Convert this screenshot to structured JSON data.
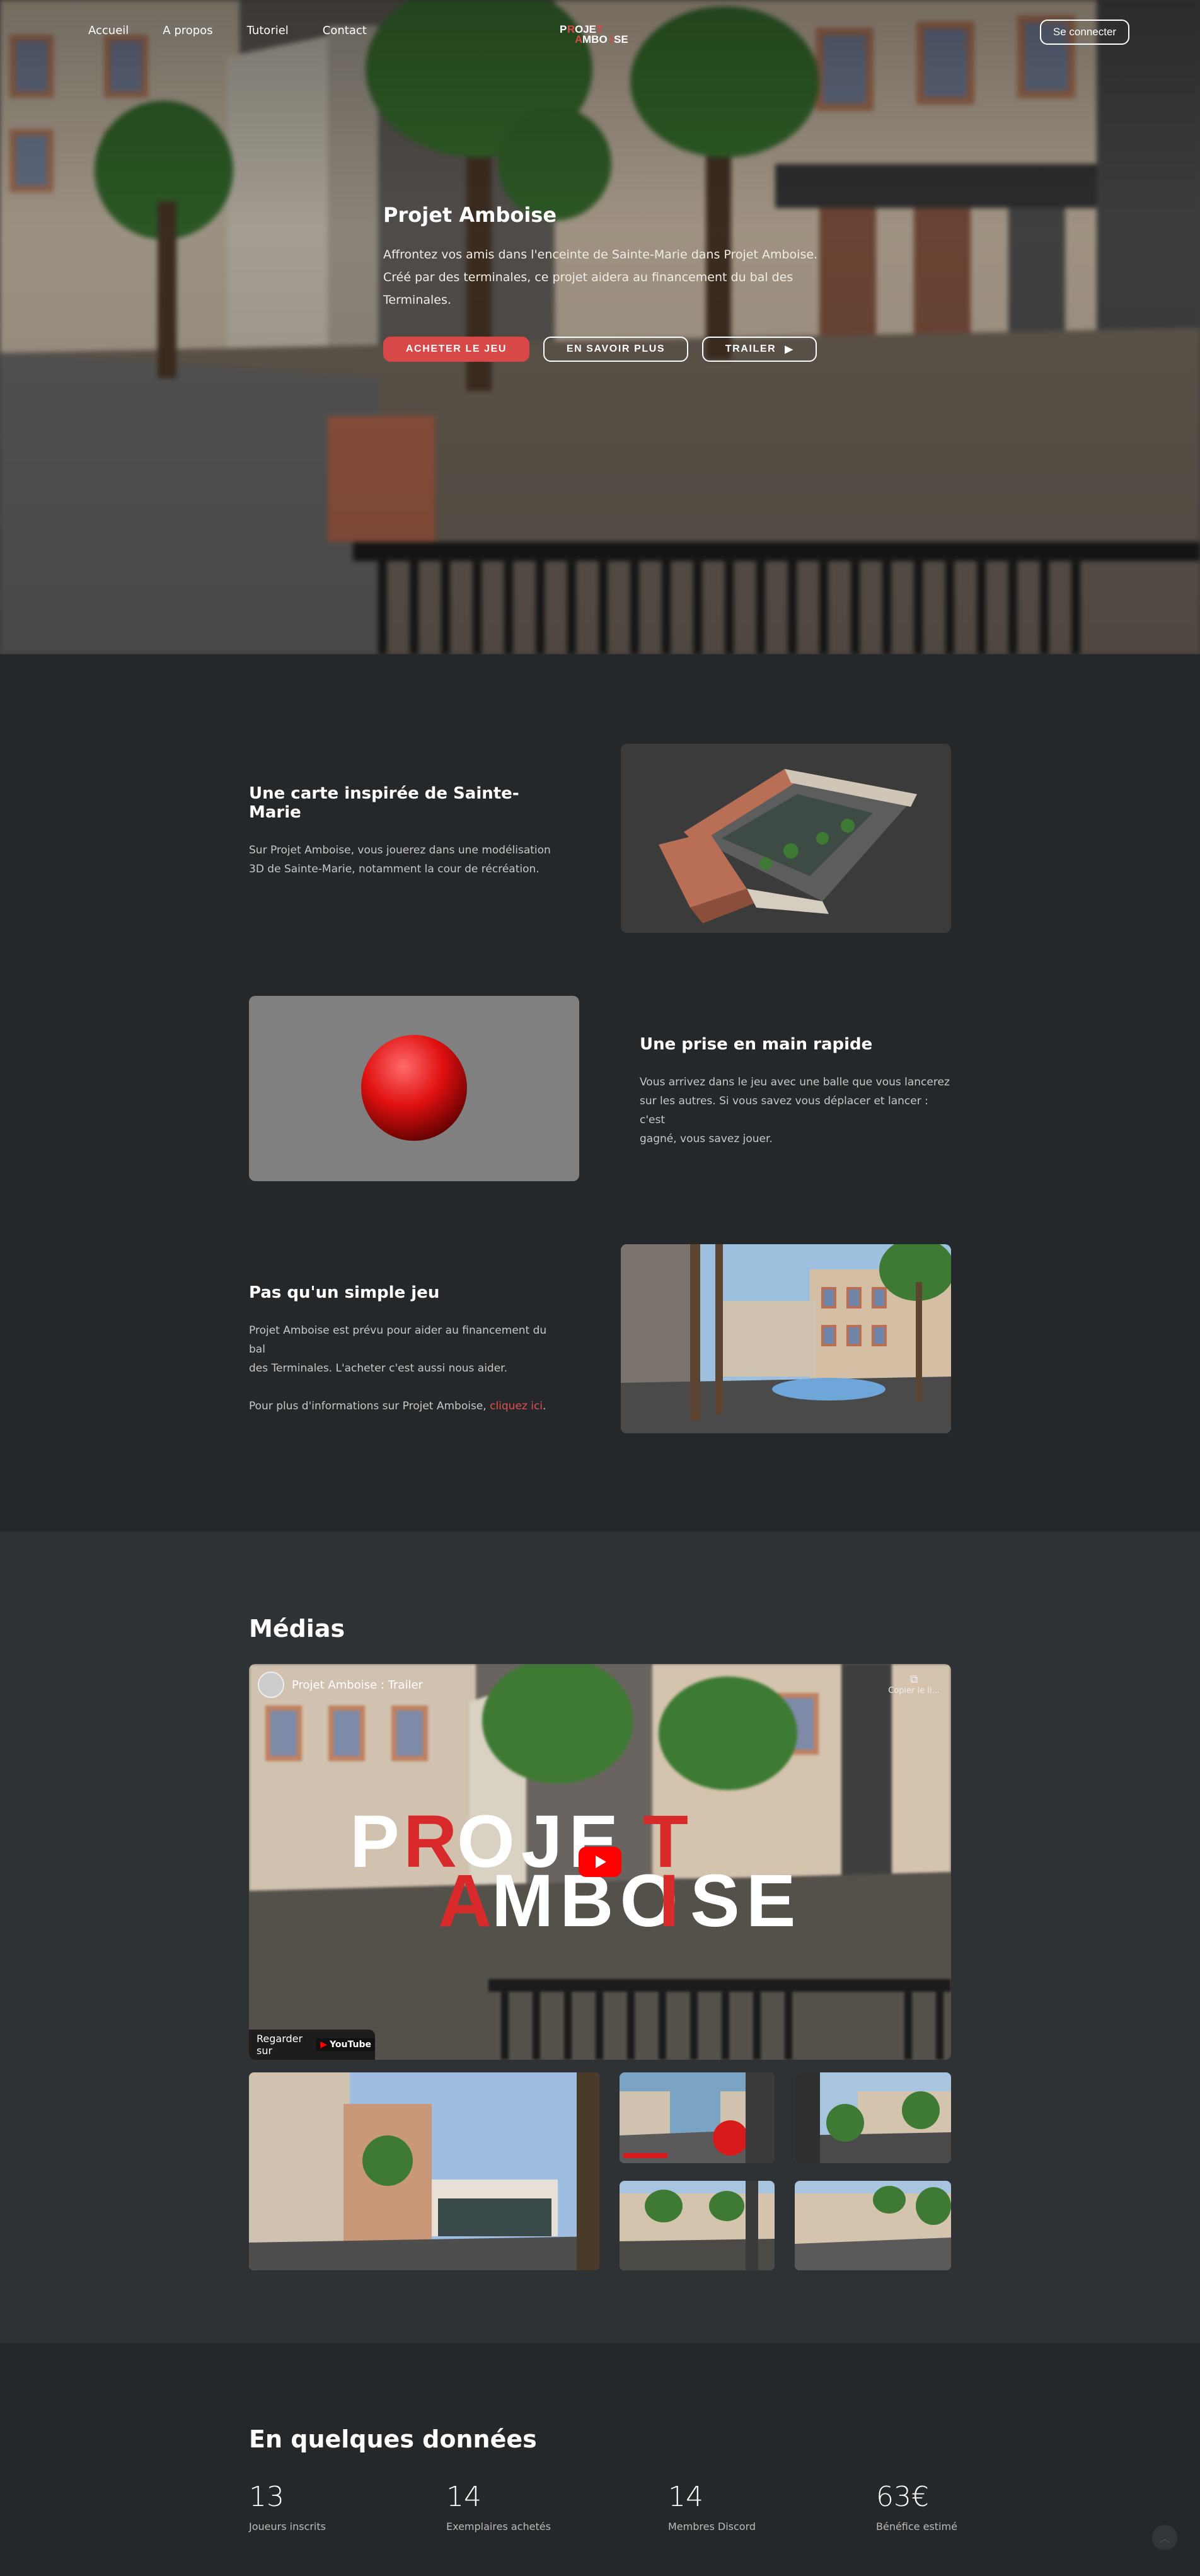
{
  "nav": {
    "links": [
      "Accueil",
      "A propos",
      "Tutoriel",
      "Contact"
    ],
    "logo_text": "PROJET AMBOISE",
    "login_label": "Se connecter"
  },
  "hero": {
    "title": "Projet Amboise",
    "line1": "Affrontez vos amis dans l'enceinte de Sainte-Marie dans Projet Amboise.",
    "line2": "Créé par des terminales, ce projet aidera au financement du bal des Terminales.",
    "buy_label": "ACHETER LE JEU",
    "more_label": "EN SAVOIR PLUS",
    "trailer_label": "TRAILER"
  },
  "features": [
    {
      "title": "Une carte inspirée de Sainte-Marie",
      "body": [
        "Sur Projet Amboise, vous jouerez dans une modélisation",
        "3D de Sainte-Marie, notamment la cour de récréation."
      ]
    },
    {
      "title": "Une prise en main rapide",
      "body": [
        "Vous arrivez dans le jeu avec une balle que vous lancerez",
        "sur les autres. Si vous savez vous déplacer et lancer : c'est",
        "gagné, vous savez jouer."
      ]
    },
    {
      "title": "Pas qu'un simple jeu",
      "body": [
        "Projet Amboise est prévu pour aider au financement du bal",
        "des Terminales. L'acheter c'est aussi nous aider."
      ],
      "more_prefix": "Pour plus d'informations sur Projet Amboise,",
      "more_link": "cliquez ici",
      "more_suffix": "."
    }
  ],
  "media": {
    "title": "Médias",
    "video_channel_title": "Projet Amboise : Trailer",
    "copy_label": "Copier le li...",
    "watch_label": "Regarder sur",
    "youtube_label": "YouTube",
    "video_logo_top": "PROJET",
    "video_logo_bottom": "AMBOISE"
  },
  "stats": {
    "title": "En quelques données",
    "items": [
      {
        "value": "13",
        "label": "Joueurs inscrits"
      },
      {
        "value": "14",
        "label": "Exemplaires achetés"
      },
      {
        "value": "14",
        "label": "Membres Discord"
      },
      {
        "value": "63€",
        "label": "Bénéfice estimé"
      }
    ]
  },
  "colors": {
    "accent": "#d84848",
    "background_dark": "#25282a",
    "background_media": "#2f3234"
  }
}
